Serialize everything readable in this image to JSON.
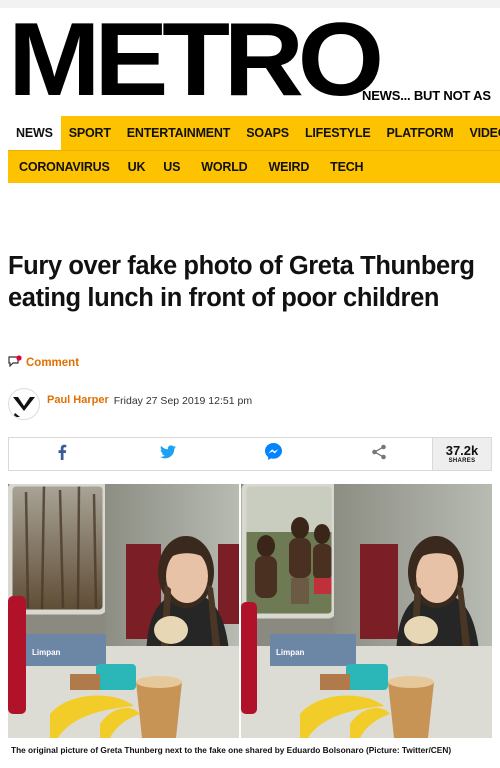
{
  "header": {
    "logo": "METRO",
    "tagline": "NEWS... BUT NOT AS"
  },
  "nav_primary": [
    {
      "label": "NEWS",
      "active": true
    },
    {
      "label": "SPORT"
    },
    {
      "label": "ENTERTAINMENT"
    },
    {
      "label": "SOAPS"
    },
    {
      "label": "LIFESTYLE"
    },
    {
      "label": "PLATFORM"
    },
    {
      "label": "VIDEO"
    }
  ],
  "nav_secondary": [
    {
      "label": "CORONAVIRUS"
    },
    {
      "label": "UK"
    },
    {
      "label": "US"
    },
    {
      "label": "WORLD"
    },
    {
      "label": "WEIRD"
    },
    {
      "label": "TECH"
    }
  ],
  "article": {
    "headline": "Fury over fake photo of Greta Thunberg eating lunch in front of poor children",
    "comment_label": "Comment",
    "author": "Paul Harper",
    "date": "Friday 27 Sep 2019 12:51 pm"
  },
  "share": {
    "buttons": [
      "facebook-icon",
      "twitter-icon",
      "messenger-icon",
      "share-icon"
    ],
    "count": "37.2k",
    "count_label": "SHARES",
    "colors": {
      "facebook": "#3b5998",
      "twitter": "#1da1f2",
      "messenger": "#0084ff",
      "share": "#777777"
    }
  },
  "image": {
    "caption": "The original picture of Greta Thunberg next to the fake one shared by Eduardo Bolsonaro  (Picture: Twitter/CEN)",
    "packet_label": "Limpan"
  },
  "colors": {
    "accent": "#fec300",
    "author": "#e07000"
  }
}
